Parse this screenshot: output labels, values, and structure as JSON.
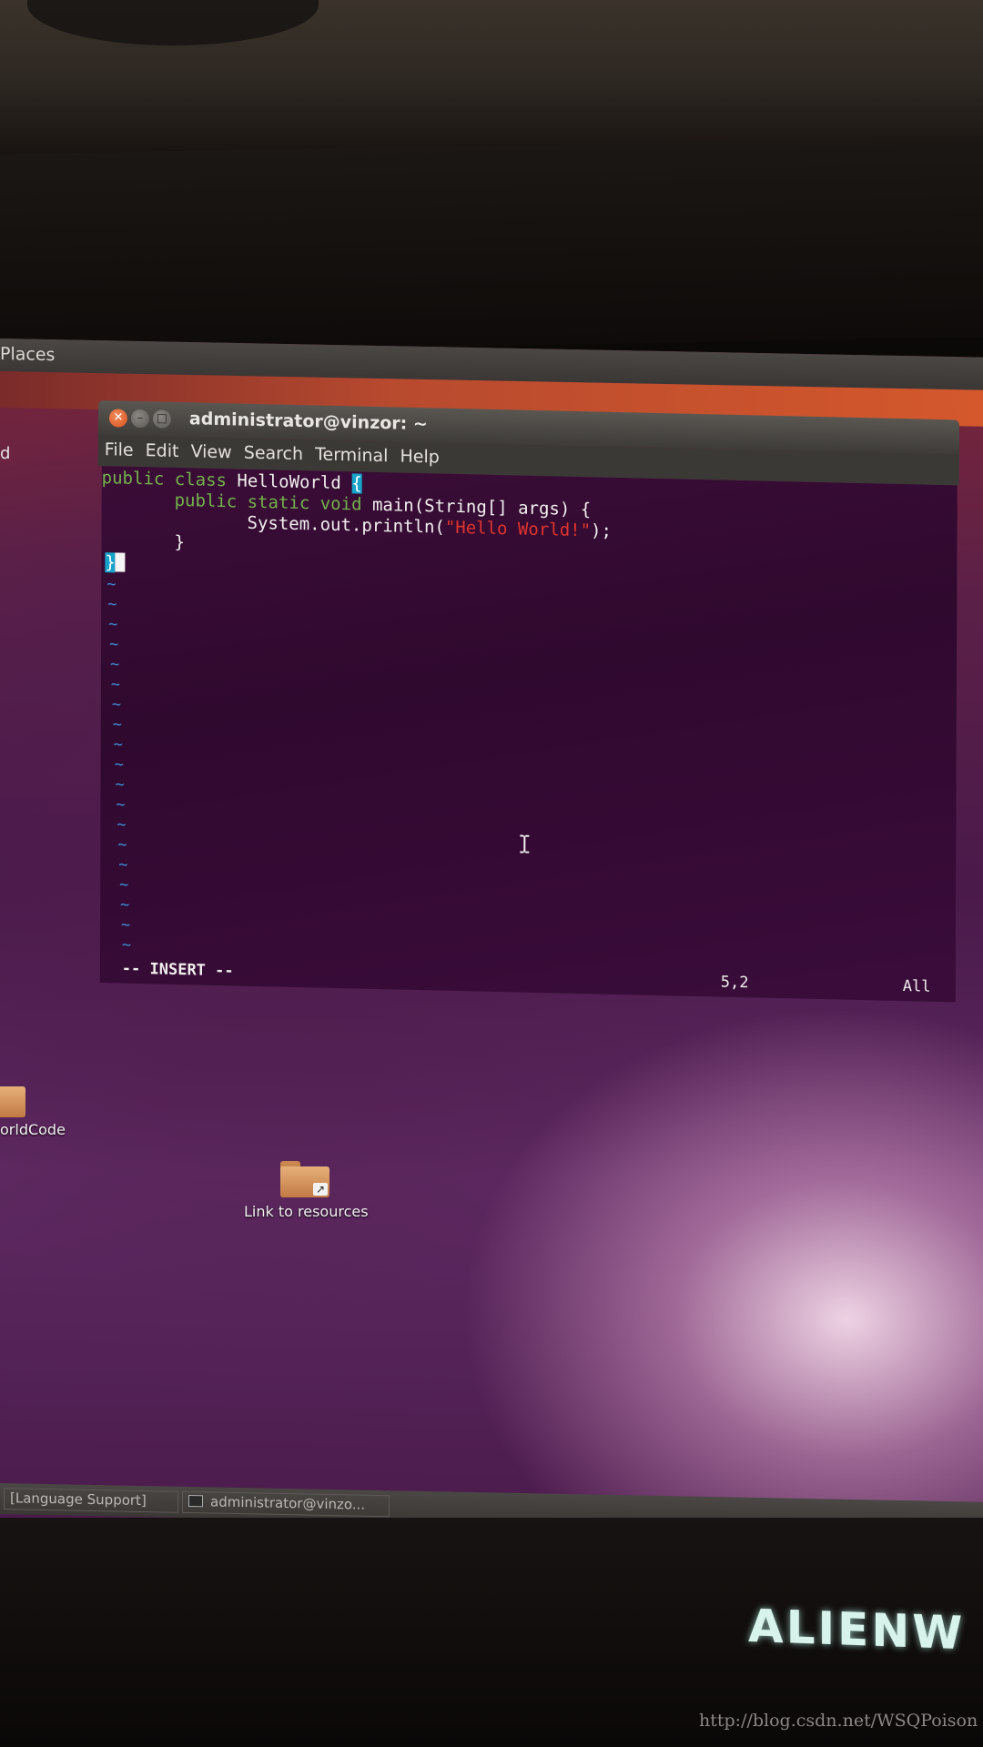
{
  "top_panel": {
    "places_label": "Places"
  },
  "desktop": {
    "left_partial_label": "d",
    "icons": [
      {
        "label": "orldCode"
      },
      {
        "label": "Link to resources"
      }
    ]
  },
  "terminal": {
    "title": "administrator@vinzor: ~",
    "menu": [
      "File",
      "Edit",
      "View",
      "Search",
      "Terminal",
      "Help"
    ],
    "code": {
      "line1_kw": "public class",
      "line1_name": " HelloWorld ",
      "line1_brace": "{",
      "line2_kw": "public static void",
      "line2_rest": " main(String[] args) {",
      "line3_pre": "System.out.println(",
      "line3_str": "\"Hello World!\"",
      "line3_post": ");",
      "line4": "}",
      "line5": "}"
    },
    "tilde": "~",
    "status": {
      "mode": "-- INSERT --",
      "position": "5,2",
      "scroll": "All"
    }
  },
  "bottom_panel": {
    "tasks": [
      "[Language Support]",
      "administrator@vinzo..."
    ]
  },
  "monitor": {
    "brand": "ALIENW"
  },
  "watermark": "http://blog.csdn.net/WSQPoison"
}
